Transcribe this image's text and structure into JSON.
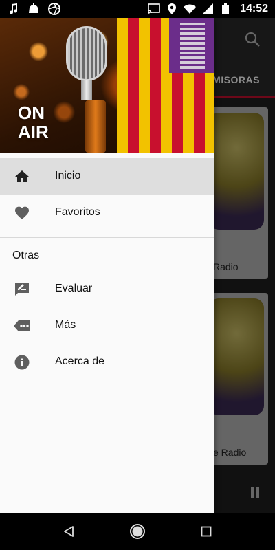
{
  "status_bar": {
    "time": "14:52",
    "left_icons": [
      "music-note-icon",
      "app-notification-icon",
      "aperture-icon"
    ],
    "right_icons": [
      "cast-icon",
      "location-icon",
      "wifi-icon",
      "signal-icon",
      "battery-icon"
    ]
  },
  "background_app": {
    "tab_label": "EMISORAS",
    "cards": [
      {
        "title": "Radio"
      },
      {
        "title": "e Radio"
      }
    ]
  },
  "drawer": {
    "header_text": "ON\nAIR",
    "items": [
      {
        "label": "Inicio",
        "icon": "home-icon",
        "active": true
      },
      {
        "label": "Favoritos",
        "icon": "heart-icon",
        "active": false
      }
    ],
    "section_title": "Otras",
    "other_items": [
      {
        "label": "Evaluar",
        "icon": "rate-review-icon"
      },
      {
        "label": "Más",
        "icon": "more-icon"
      },
      {
        "label": "Acerca de",
        "icon": "info-icon"
      }
    ]
  },
  "colors": {
    "accent": "#c8102e",
    "drawer_bg": "#fafafa",
    "active_item_bg": "#dedede",
    "icon_gray": "#5f5f5f"
  }
}
